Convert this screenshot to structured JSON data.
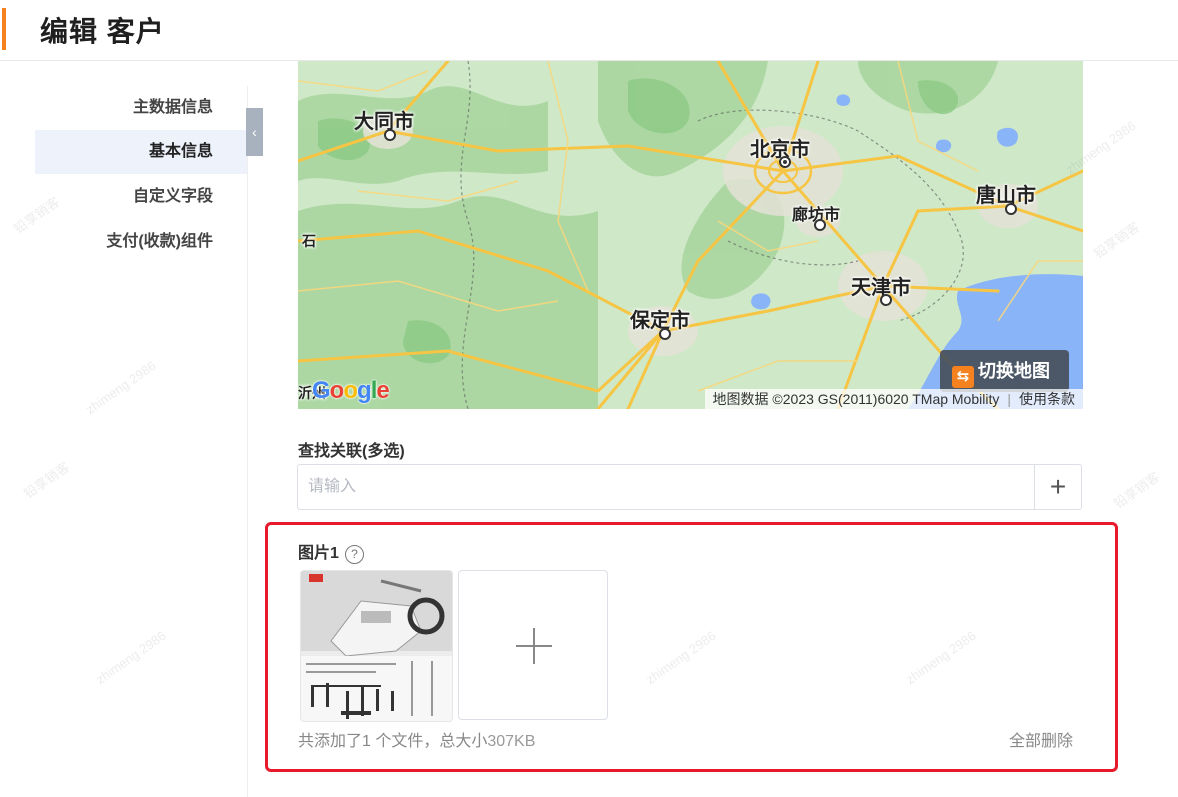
{
  "header": {
    "title": "编辑 客户"
  },
  "sidebar": {
    "items": [
      {
        "label": "主数据信息"
      },
      {
        "label": "基本信息"
      },
      {
        "label": "自定义字段"
      },
      {
        "label": "支付(收款)组件"
      }
    ],
    "active_index": 1,
    "collapse_glyph": "‹"
  },
  "map": {
    "cities": [
      {
        "name": "大同市"
      },
      {
        "name": "北京市"
      },
      {
        "name": "唐山市"
      },
      {
        "name": "廊坊市"
      },
      {
        "name": "天津市"
      },
      {
        "name": "保定市"
      }
    ],
    "edge_labels": {
      "left_top": "石",
      "bottom_left": "沂州"
    },
    "switch_label": "切换地图",
    "switch_icon": "⇆",
    "logo": "Google",
    "attribution": "地图数据 ©2023 GS(2011)6020 TMap Mobility",
    "terms": "使用条款",
    "colors": {
      "land": "#cfe8c8",
      "forest": "#9fd19a",
      "water": "#8ab4f8",
      "road": "#f6c544"
    }
  },
  "related": {
    "label": "查找关联(多选)",
    "placeholder": "请输入",
    "add_glyph": "+"
  },
  "images": {
    "label": "图片1",
    "help_glyph": "?",
    "summary_prefix": "共添加了1 个文件，总大小",
    "summary_size": "307KB",
    "delete_all": "全部删除",
    "highlight_color": "#e8192c"
  },
  "watermark": {
    "text_a": "铅享销客",
    "text_b": "zhimeng 2986"
  }
}
